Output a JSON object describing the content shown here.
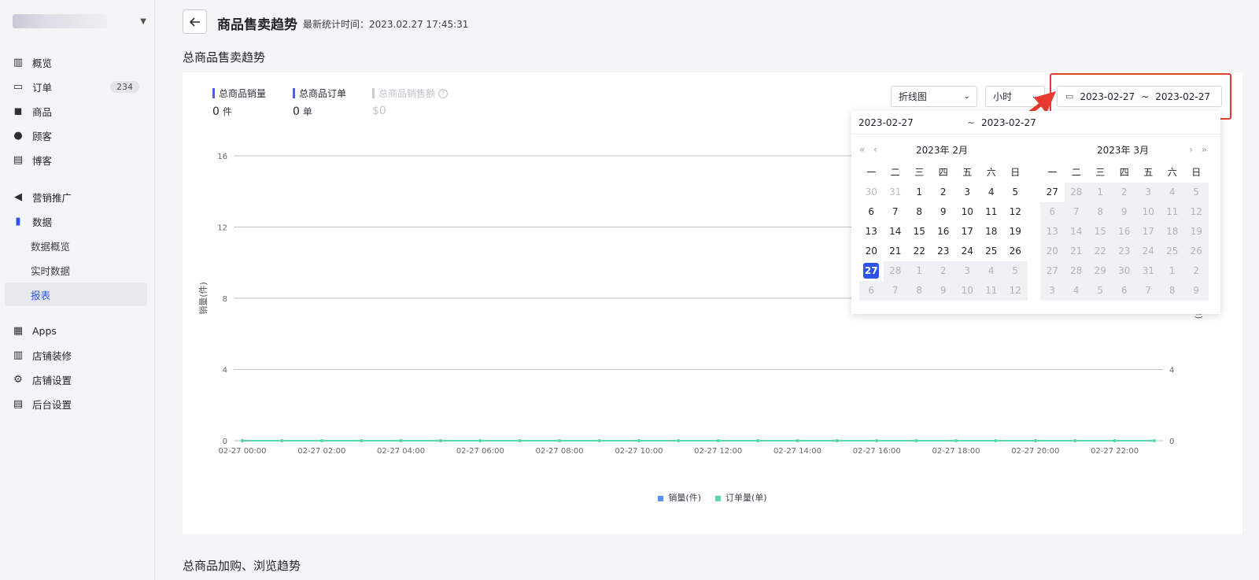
{
  "sidebar": {
    "nav": [
      {
        "label": "概览",
        "icon": "dashboard-icon"
      },
      {
        "label": "订单",
        "icon": "inbox-icon",
        "badge": "234"
      },
      {
        "label": "商品",
        "icon": "bag-icon"
      },
      {
        "label": "顾客",
        "icon": "user-icon"
      },
      {
        "label": "博客",
        "icon": "blog-icon"
      },
      {
        "label": "营销推广",
        "icon": "megaphone-icon"
      },
      {
        "label": "数据",
        "icon": "bar-chart-icon"
      },
      {
        "label": "Apps",
        "icon": "apps-icon"
      },
      {
        "label": "店铺装修",
        "icon": "store-icon"
      },
      {
        "label": "店铺设置",
        "icon": "gear-icon"
      },
      {
        "label": "后台设置",
        "icon": "server-icon"
      }
    ],
    "data_sub": [
      {
        "label": "数据概览"
      },
      {
        "label": "实时数据"
      },
      {
        "label": "报表"
      }
    ]
  },
  "header": {
    "title": "商品售卖趋势",
    "update_time": "最新统计时间：2023.02.27 17:45:31"
  },
  "section": {
    "title": "总商品售卖趋势",
    "title2": "总商品加购、浏览趋势"
  },
  "metrics": [
    {
      "label": "总商品销量",
      "value": "0",
      "unit": "件",
      "color": "#4c5fd5"
    },
    {
      "label": "总商品订单",
      "value": "0",
      "unit": "单",
      "color": "#4c5fd5"
    },
    {
      "label": "总商品销售额",
      "value": "$0",
      "unit": "",
      "color": "#c8cbd0"
    }
  ],
  "controls": {
    "chart_type": "折线图",
    "granularity": "小时",
    "date_start": "2023-02-27",
    "date_end": "2023-02-27",
    "tilde": "~"
  },
  "picker": {
    "input_start": "2023-02-27",
    "input_tilde": "~",
    "input_end": "2023-02-27",
    "left_month": "2023年 2月",
    "right_month": "2023年 3月",
    "weekdays": [
      "一",
      "二",
      "三",
      "四",
      "五",
      "六",
      "日"
    ],
    "left_days": [
      [
        "30",
        "31",
        "1",
        "2",
        "3",
        "4",
        "5"
      ],
      [
        "6",
        "7",
        "8",
        "9",
        "10",
        "11",
        "12"
      ],
      [
        "13",
        "14",
        "15",
        "16",
        "17",
        "18",
        "19"
      ],
      [
        "20",
        "21",
        "22",
        "23",
        "24",
        "25",
        "26"
      ],
      [
        "27",
        "28",
        "1",
        "2",
        "3",
        "4",
        "5"
      ],
      [
        "6",
        "7",
        "8",
        "9",
        "10",
        "11",
        "12"
      ]
    ],
    "right_days": [
      [
        "27",
        "28",
        "1",
        "2",
        "3",
        "4",
        "5"
      ],
      [
        "6",
        "7",
        "8",
        "9",
        "10",
        "11",
        "12"
      ],
      [
        "13",
        "14",
        "15",
        "16",
        "17",
        "18",
        "19"
      ],
      [
        "20",
        "21",
        "22",
        "23",
        "24",
        "25",
        "26"
      ],
      [
        "27",
        "28",
        "29",
        "30",
        "31",
        "1",
        "2"
      ],
      [
        "3",
        "4",
        "5",
        "6",
        "7",
        "8",
        "9"
      ]
    ]
  },
  "chart_data": {
    "type": "line",
    "x": [
      "02-27 00:00",
      "02-27 01:00",
      "02-27 02:00",
      "02-27 03:00",
      "02-27 04:00",
      "02-27 05:00",
      "02-27 06:00",
      "02-27 07:00",
      "02-27 08:00",
      "02-27 09:00",
      "02-27 10:00",
      "02-27 11:00",
      "02-27 12:00",
      "02-27 13:00",
      "02-27 14:00",
      "02-27 15:00",
      "02-27 16:00",
      "02-27 17:00",
      "02-27 18:00",
      "02-27 19:00",
      "02-27 20:00",
      "02-27 21:00",
      "02-27 22:00",
      "02-27 23:00"
    ],
    "x_tick_labels": [
      "02-27 00:00",
      "02-27 02:00",
      "02-27 04:00",
      "02-27 06:00",
      "02-27 08:00",
      "02-27 10:00",
      "02-27 12:00",
      "02-27 14:00",
      "02-27 16:00",
      "02-27 18:00",
      "02-27 20:00",
      "02-27 22:00"
    ],
    "series": [
      {
        "name": "销量(件)",
        "color": "#5b8ff9",
        "values": [
          0,
          0,
          0,
          0,
          0,
          0,
          0,
          0,
          0,
          0,
          0,
          0,
          0,
          0,
          0,
          0,
          0,
          0,
          0,
          0,
          0,
          0,
          0,
          0
        ]
      },
      {
        "name": "订单量(单)",
        "color": "#5ad8a6",
        "values": [
          0,
          0,
          0,
          0,
          0,
          0,
          0,
          0,
          0,
          0,
          0,
          0,
          0,
          0,
          0,
          0,
          0,
          0,
          0,
          0,
          0,
          0,
          0,
          0
        ]
      }
    ],
    "ylabel": "销量(件)",
    "ylabel_right": "订单量(单)",
    "ylim": [
      0,
      16
    ],
    "y_ticks": [
      "0",
      "4",
      "8",
      "12",
      "16"
    ],
    "y_ticks_right": [
      "0",
      "4"
    ],
    "grid": true,
    "legend": "bottom"
  }
}
